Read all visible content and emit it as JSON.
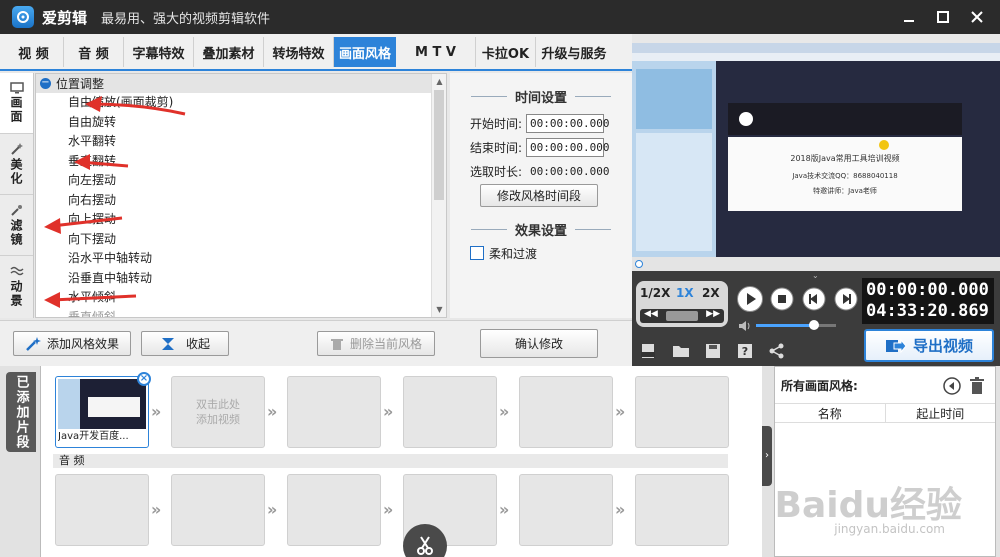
{
  "window": {
    "app_name": "爱剪辑",
    "slogan": "最易用、强大的视频剪辑软件"
  },
  "tabs": [
    {
      "label": "视 频"
    },
    {
      "label": "音 频"
    },
    {
      "label": "字幕特效"
    },
    {
      "label": "叠加素材"
    },
    {
      "label": "转场特效"
    },
    {
      "label": "画面风格",
      "active": true
    },
    {
      "label": "M T V"
    },
    {
      "label": "卡拉OK"
    },
    {
      "label": "升级与服务"
    }
  ],
  "side_tabs": [
    {
      "label": "画面",
      "icon": "screen-icon",
      "active": true
    },
    {
      "label": "美化",
      "icon": "magic-wand-icon"
    },
    {
      "label": "滤镜",
      "icon": "sparkle-icon"
    },
    {
      "label": "动景",
      "icon": "wave-icon"
    }
  ],
  "tree": {
    "root": "位置调整",
    "items": [
      "自由缩放(画面裁剪)",
      "自由旋转",
      "水平翻转",
      "垂直翻转",
      "向左摆动",
      "向右摆动",
      "向上摆动",
      "向下摆动",
      "沿水平中轴转动",
      "沿垂直中轴转动",
      "水平倾斜",
      "垂直倾斜"
    ]
  },
  "time_settings": {
    "title": "时间设置",
    "start_label": "开始时间:",
    "start_value": "00:00:00.000",
    "end_label": "结束时间:",
    "end_value": "00:00:00.000",
    "duration_label": "选取时长:",
    "duration_value": "00:00:00.000",
    "modify_button": "修改风格时间段"
  },
  "effect_settings": {
    "title": "效果设置",
    "smooth_label": "柔和过渡"
  },
  "actions": {
    "add_style": "添加风格效果",
    "collapse": "收起",
    "delete_style": "删除当前风格",
    "confirm": "确认修改"
  },
  "player": {
    "speed_half": "1/2X",
    "speed_1x": "1X",
    "speed_2x": "2X",
    "current_time": "00:00:00.000",
    "total_time": "04:33:20.869",
    "export_label": "导出视频",
    "volume": 0.72
  },
  "preview": {
    "slide_title": "2018版Java常用工具培训视频",
    "slide_line2": "Java技术交流QQ：8688040118",
    "slide_line3": "特邀讲师：Java老师"
  },
  "timeline": {
    "side_label": "已添加片段",
    "clip1_name": "Java开发百度...",
    "empty_hint_line1": "双击此处",
    "empty_hint_line2": "添加视频",
    "audio_label": "音 频"
  },
  "styles_panel": {
    "title": "所有画面风格:",
    "col_name": "名称",
    "col_time": "起止时间"
  },
  "watermark": {
    "brand": "Baidu经验",
    "url": "jingyan.baidu.com"
  }
}
